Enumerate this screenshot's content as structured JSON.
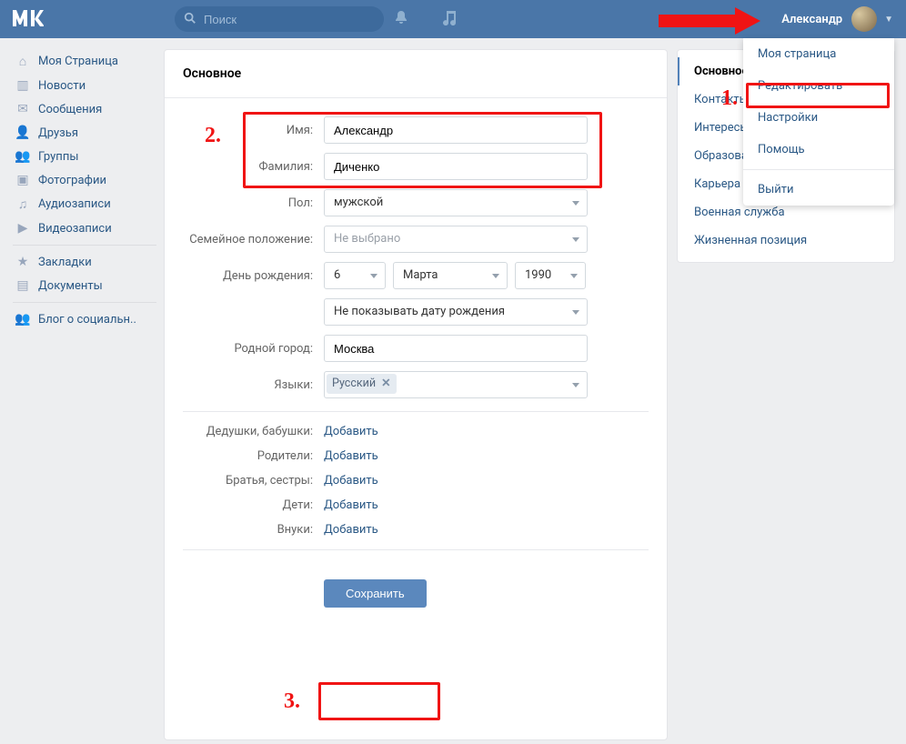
{
  "header": {
    "search_placeholder": "Поиск",
    "username": "Александр"
  },
  "leftnav": {
    "items": [
      {
        "icon": "home",
        "label": "Моя Страница"
      },
      {
        "icon": "news",
        "label": "Новости"
      },
      {
        "icon": "messages",
        "label": "Сообщения"
      },
      {
        "icon": "friends",
        "label": "Друзья"
      },
      {
        "icon": "groups",
        "label": "Группы"
      },
      {
        "icon": "photos",
        "label": "Фотографии"
      },
      {
        "icon": "audio",
        "label": "Аудиозаписи"
      },
      {
        "icon": "video",
        "label": "Видеозаписи"
      }
    ],
    "items2": [
      {
        "icon": "star",
        "label": "Закладки"
      },
      {
        "icon": "docs",
        "label": "Документы"
      }
    ],
    "items3": [
      {
        "icon": "blog",
        "label": "Блог о социальн.."
      }
    ]
  },
  "form": {
    "title": "Основное",
    "labels": {
      "first_name": "Имя:",
      "last_name": "Фамилия:",
      "gender": "Пол:",
      "marital": "Семейное положение:",
      "dob": "День рождения:",
      "hometown": "Родной город:",
      "languages": "Языки:"
    },
    "values": {
      "first_name": "Александр",
      "last_name": "Диченко",
      "gender": "мужской",
      "marital": "Не выбрано",
      "dob_day": "6",
      "dob_month": "Марта",
      "dob_year": "1990",
      "dob_visibility": "Не показывать дату рождения",
      "hometown": "Москва",
      "language_token": "Русский"
    },
    "family": {
      "rows": [
        {
          "label": "Дедушки, бабушки:",
          "link": "Добавить"
        },
        {
          "label": "Родители:",
          "link": "Добавить"
        },
        {
          "label": "Братья, сестры:",
          "link": "Добавить"
        },
        {
          "label": "Дети:",
          "link": "Добавить"
        },
        {
          "label": "Внуки:",
          "link": "Добавить"
        }
      ]
    },
    "save": "Сохранить"
  },
  "tabs": {
    "items": [
      "Основное",
      "Контакты",
      "Интересы",
      "Образование",
      "Карьера",
      "Военная служба",
      "Жизненная позиция"
    ]
  },
  "usermenu": {
    "items": [
      "Моя страница",
      "Редактировать",
      "Настройки",
      "Помощь"
    ],
    "logout": "Выйти"
  },
  "annotations": {
    "n1": "1.",
    "n2": "2.",
    "n3": "3."
  }
}
